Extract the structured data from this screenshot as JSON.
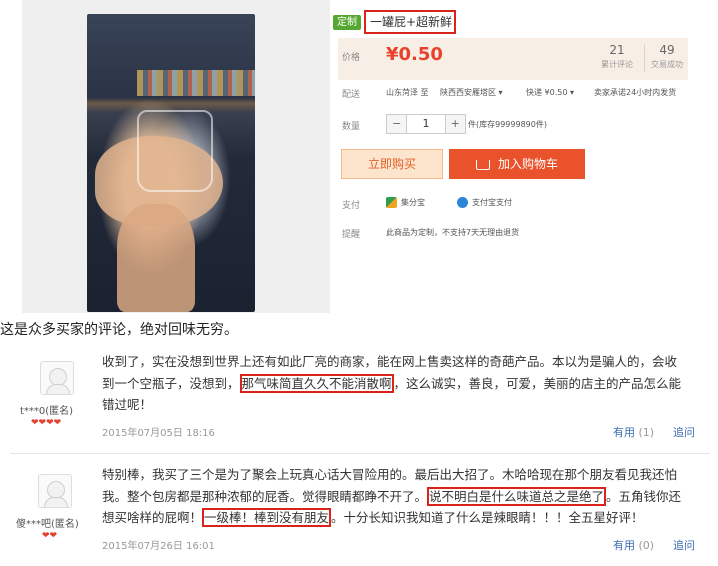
{
  "product": {
    "tag": "定制",
    "title": "一罐屁+超新鲜",
    "price_label": "价格",
    "price": "¥0.50",
    "reviews_count": "21",
    "reviews_label": "累计评论",
    "sales_count": "49",
    "sales_label": "交易成功",
    "delivery_label": "配送",
    "delivery_from": "山东菏泽 至",
    "delivery_to": "陕西西安雁塔区",
    "delivery_method": "快递 ¥0.50",
    "delivery_promise": "卖家承诺24小时内发货",
    "qty_label": "数量",
    "qty_minus": "−",
    "qty_value": "1",
    "qty_plus": "+",
    "stock": "件(库存99999890件)",
    "buy_now": "立即购买",
    "add_cart": "加入购物车",
    "pay_label": "支付",
    "pay_method_1": "集分宝",
    "pay_method_2": "支付宝支付",
    "tip_label": "提醒",
    "tip_text": "此商品为定制，不支持7天无理由退货"
  },
  "heading": "这是众多买家的评论，绝对回味无穷。",
  "comments": [
    {
      "user": "t***0(匿名)",
      "hearts": "❤❤❤❤",
      "line1": "收到了，实在没想到世界上还有如此厂亮的商家，能在网上售卖这样的奇葩产品。本以为是骗人的，会收",
      "line2_a": "到一个空瓶子，没想到，",
      "line2_box": "那气味简直久久不能消散啊",
      "line2_b": "，这么诚实，善良，可爱，美丽的店主的产品怎么能",
      "line3": "错过呢！",
      "date": "2015年07月05日 18:16",
      "useful": "有用",
      "useful_count": "(1)",
      "reply": "追问"
    },
    {
      "user": "傻***吧(匿名)",
      "hearts": "❤❤",
      "line1": "特别棒，我买了三个是为了聚会上玩真心话大冒险用的。最后出大招了。木哈哈现在那个朋友看见我还怕",
      "line2_a": "我。整个包房都是那种浓郁的屁香。觉得眼睛都睁不开了。",
      "line2_box": "说不明白是什么味道总之是绝了",
      "line2_b": "。五角钱你还",
      "line3_a": "想买啥样的屁啊！",
      "line3_box": "一级棒！棒到没有朋友",
      "line3_b": "。十分长知识我知道了什么是辣眼睛！！！全五星好评！",
      "date": "2015年07月26日 16:01",
      "useful": "有用",
      "useful_count": "(0)",
      "reply": "追问"
    }
  ]
}
